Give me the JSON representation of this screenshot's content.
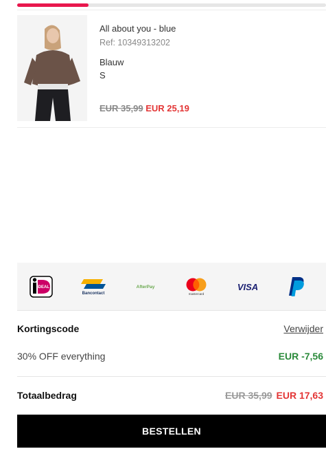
{
  "checkout": {
    "progress_fraction": 0.23
  },
  "product": {
    "name": "All about you - blue",
    "ref": "Ref: 10349313202",
    "color": "Blauw",
    "size": "S",
    "old_price": "EUR 35,99",
    "new_price": "EUR 25,19"
  },
  "payment_methods": {
    "ideal_label": "iDEAL",
    "bancontact_label": "Bancontact",
    "afterpay_label": "AfterPay",
    "mastercard_label": "mastercard",
    "visa_label": "VISA"
  },
  "discount": {
    "heading": "Kortingscode",
    "remove_link": "Verwijder",
    "code_description": "30% OFF everything",
    "amount": "EUR -7,56"
  },
  "total": {
    "label": "Totaalbedrag",
    "old_price": "EUR 35,99",
    "new_price": "EUR 17,63"
  },
  "order_button": {
    "label": "BESTELLEN"
  },
  "colors": {
    "accent": "#e8174d",
    "price_red": "#e33535",
    "discount_green": "#2a8a3a",
    "button_black": "#000000"
  }
}
